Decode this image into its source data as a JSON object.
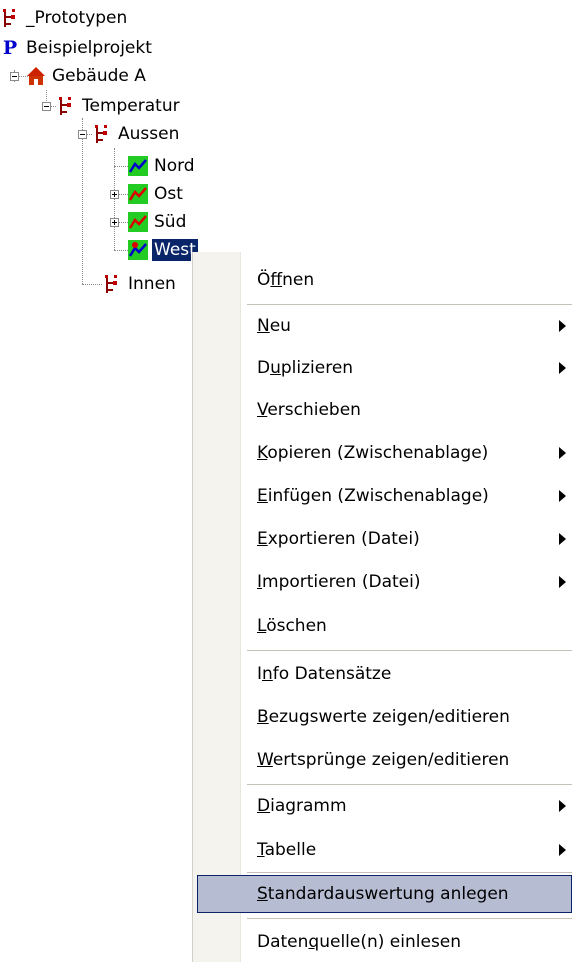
{
  "tree": {
    "items": [
      {
        "label": "_Prototypen",
        "icon": "proto-tree-icon"
      },
      {
        "label": "Beispielprojekt",
        "icon": "project-p-icon"
      },
      {
        "label": "Gebäude A",
        "icon": "house-icon"
      },
      {
        "label": "Temperatur",
        "icon": "proto-tree-icon"
      },
      {
        "label": "Aussen",
        "icon": "proto-tree-icon"
      },
      {
        "label": "Nord",
        "icon": "chart-blue-icon"
      },
      {
        "label": "Ost",
        "icon": "chart-red-icon"
      },
      {
        "label": "Süd",
        "icon": "chart-red-icon"
      },
      {
        "label": "West",
        "icon": "chart-blue-marker-icon"
      },
      {
        "label": "Innen",
        "icon": "proto-tree-icon"
      }
    ]
  },
  "menu": {
    "items": [
      {
        "pre": "Ö",
        "acc": "f",
        "post": "fnen"
      },
      {
        "pre": "",
        "acc": "N",
        "post": "eu"
      },
      {
        "pre": "D",
        "acc": "u",
        "post": "plizieren"
      },
      {
        "pre": "",
        "acc": "V",
        "post": "erschieben"
      },
      {
        "pre": "",
        "acc": "K",
        "post": "opieren (Zwischenablage)"
      },
      {
        "pre": "",
        "acc": "E",
        "post": "infügen (Zwischenablage)"
      },
      {
        "pre": "",
        "acc": "E",
        "post": "xportieren (Datei)"
      },
      {
        "pre": "",
        "acc": "I",
        "post": "mportieren (Datei)"
      },
      {
        "pre": "",
        "acc": "L",
        "post": "öschen"
      },
      {
        "pre": "I",
        "acc": "n",
        "post": "fo Datensätze"
      },
      {
        "pre": "",
        "acc": "B",
        "post": "ezugswerte zeigen/editieren"
      },
      {
        "pre": "",
        "acc": "W",
        "post": "ertsprünge zeigen/editieren"
      },
      {
        "pre": "",
        "acc": "D",
        "post": "iagramm"
      },
      {
        "pre": "",
        "acc": "T",
        "post": "abelle"
      },
      {
        "pre": "",
        "acc": "S",
        "post": "tandardauswertung anlegen"
      },
      {
        "pre": "Daten",
        "acc": "q",
        "post": "uelle(n) einlesen"
      }
    ]
  },
  "colors": {
    "selection": "#0a246a",
    "menu_hover": "#b6bdd2",
    "menu_strip": "#f4f3ee"
  }
}
